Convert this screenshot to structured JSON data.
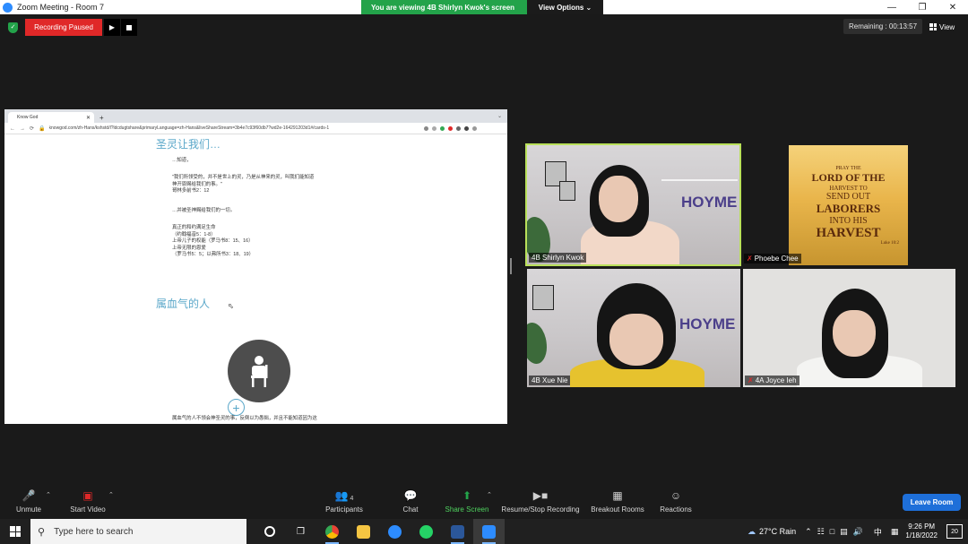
{
  "window": {
    "title": "Zoom Meeting - Room 7",
    "viewing_banner": "You are viewing 4B Shirlyn Kwok's screen",
    "view_options": "View Options ⌄"
  },
  "recording": {
    "status": "Recording Paused",
    "remaining": "Remaining : 00:13:57",
    "view_label": "View"
  },
  "browser": {
    "tab_title": "Know God",
    "url": "knowgod.com/zh-Hans/kshstd/l?ldcdugtshare&primaryLanguage=zh-Hans&liveShareStream=3b4e7c93f60db7?wd2e-164291203d1#/cards-1",
    "heading1": "圣灵让我们…",
    "p1": "…知道，",
    "p2a": "\"我们所领受的，并不是世上的灵，乃是从神来的灵，叫我们能知道",
    "p2b": "神开恩赐给我们的事。\"",
    "p2c": "哥林多前书2：12",
    "p3": "…并被圣神赐给我们的一切。",
    "p4a": "真正的和约满足生命",
    "p4b": "（约翰福音5：1-8）",
    "p4c": "上帝儿子的权能（罗马书8：15、16）",
    "p4d": "上帝无限的恩爱",
    "p4e": "（罗马书5：5；以弗所书3：18、19）",
    "heading2": "属血气的人",
    "p5": "属血气的人不领会神圣灵的事，反倒以为愚拙，并且不能知道因为这"
  },
  "participants": [
    {
      "name": "4B Shirlyn Kwok"
    },
    {
      "name": "Phoebe Chee"
    },
    {
      "name": "4B Xue Nie"
    },
    {
      "name": "4A Joyce Ieh"
    }
  ],
  "harvest_image": {
    "line1": "PRAY THE",
    "line2": "LORD OF THE",
    "line3": "HARVEST TO",
    "line4": "SEND OUT",
    "line5": "LABORERS",
    "line6": "INTO HIS",
    "line7": "HARVEST",
    "ref": "Luke 10:2"
  },
  "wall_text": "HOYME",
  "toolbar": {
    "unmute": "Unmute",
    "start_video": "Start Video",
    "participants": "Participants",
    "participants_count": "4",
    "chat": "Chat",
    "share_screen": "Share Screen",
    "resume_stop_recording": "Resume/Stop Recording",
    "breakout_rooms": "Breakout Rooms",
    "reactions": "Reactions",
    "leave_room": "Leave Room"
  },
  "taskbar": {
    "search_placeholder": "Type here to search",
    "weather": "27°C  Rain",
    "lang": "中",
    "time": "9:26 PM",
    "date": "1/18/2022",
    "notifications": "20"
  },
  "colors": {
    "accent_green": "#23a34a",
    "record_red": "#e02828",
    "leave_blue": "#1e6fd9",
    "active_speaker": "#b9e05a",
    "link_blue": "#5aa7c9"
  }
}
